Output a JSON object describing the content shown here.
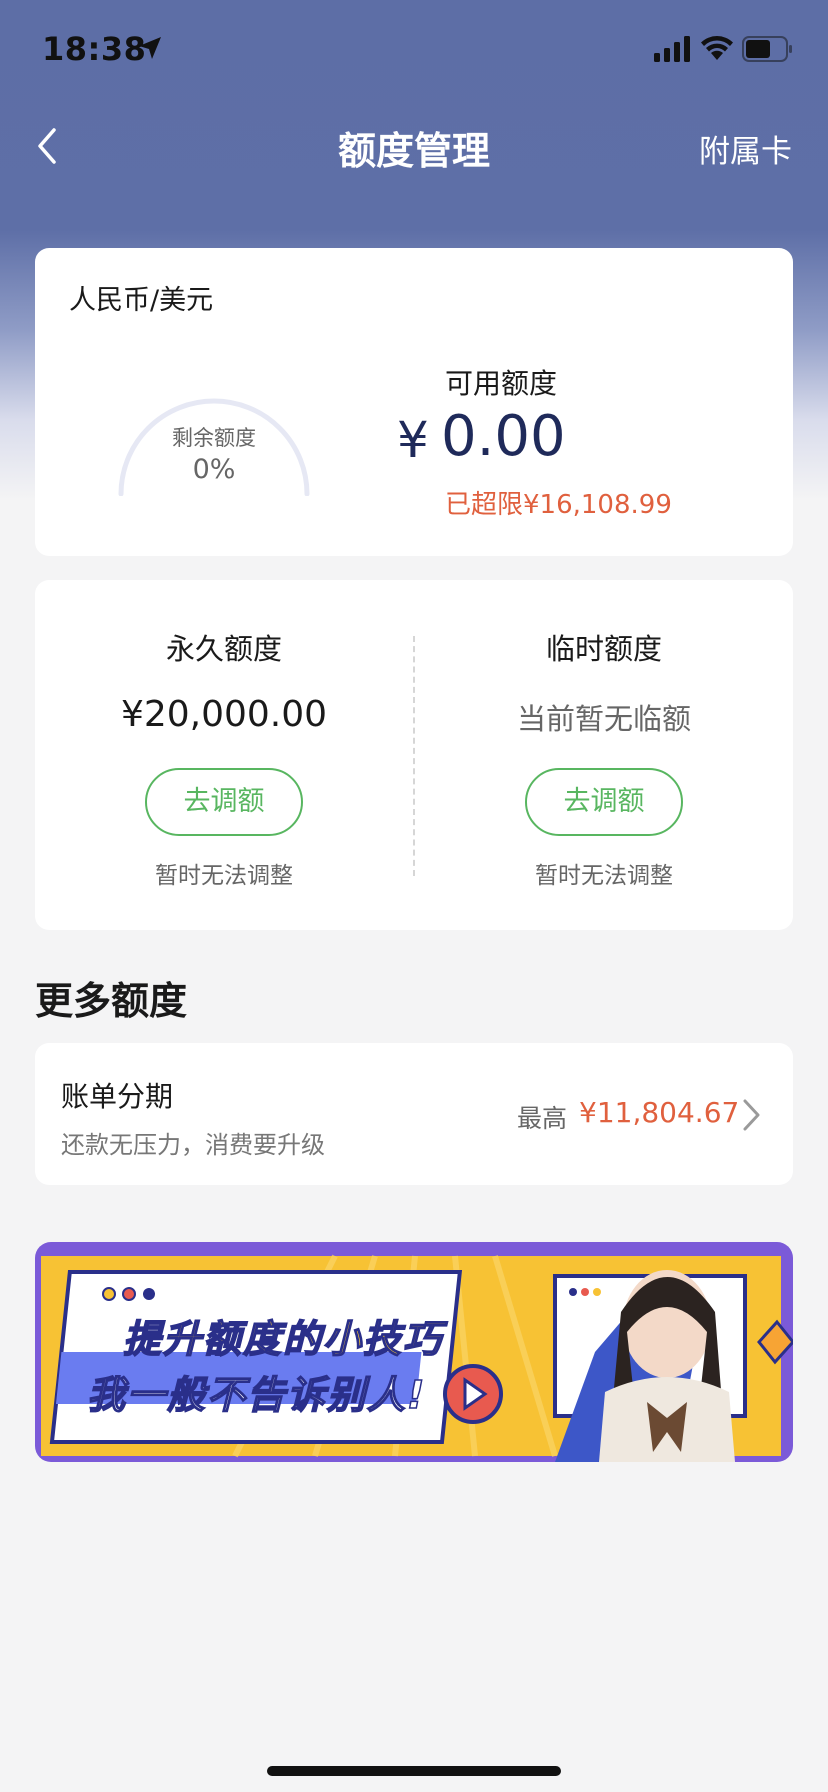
{
  "status_bar": {
    "time": "18:38"
  },
  "nav": {
    "title": "额度管理",
    "right_action": "附属卡"
  },
  "currency_card": {
    "title": "人民币/美元",
    "gauge_label": "剩余额度",
    "gauge_value": "0%",
    "gauge_fraction": 0.0,
    "available_label": "可用额度",
    "available_symbol": "¥",
    "available_value": "0.00",
    "over_limit_text": "已超限¥16,108.99"
  },
  "limits": {
    "permanent": {
      "title": "永久额度",
      "amount": "¥20,000.00",
      "button": "去调额",
      "note": "暂时无法调整"
    },
    "temporary": {
      "title": "临时额度",
      "amount": "当前暂无临额",
      "button": "去调额",
      "note": "暂时无法调整"
    }
  },
  "more_section": {
    "title": "更多额度"
  },
  "installment": {
    "title": "账单分期",
    "subtitle": "还款无压力，消费要升级",
    "max_label": "最高",
    "max_value": "¥11,804.67"
  },
  "banner": {
    "line1": "提升额度的小技巧",
    "line2": "我一般不告诉别人!",
    "page_count": 2,
    "active_page": 1
  },
  "colors": {
    "header_bg": "#5d6ea6",
    "accent_green": "#58b660",
    "alert_orange": "#e0603e",
    "amount_navy": "#1f2a5a"
  }
}
